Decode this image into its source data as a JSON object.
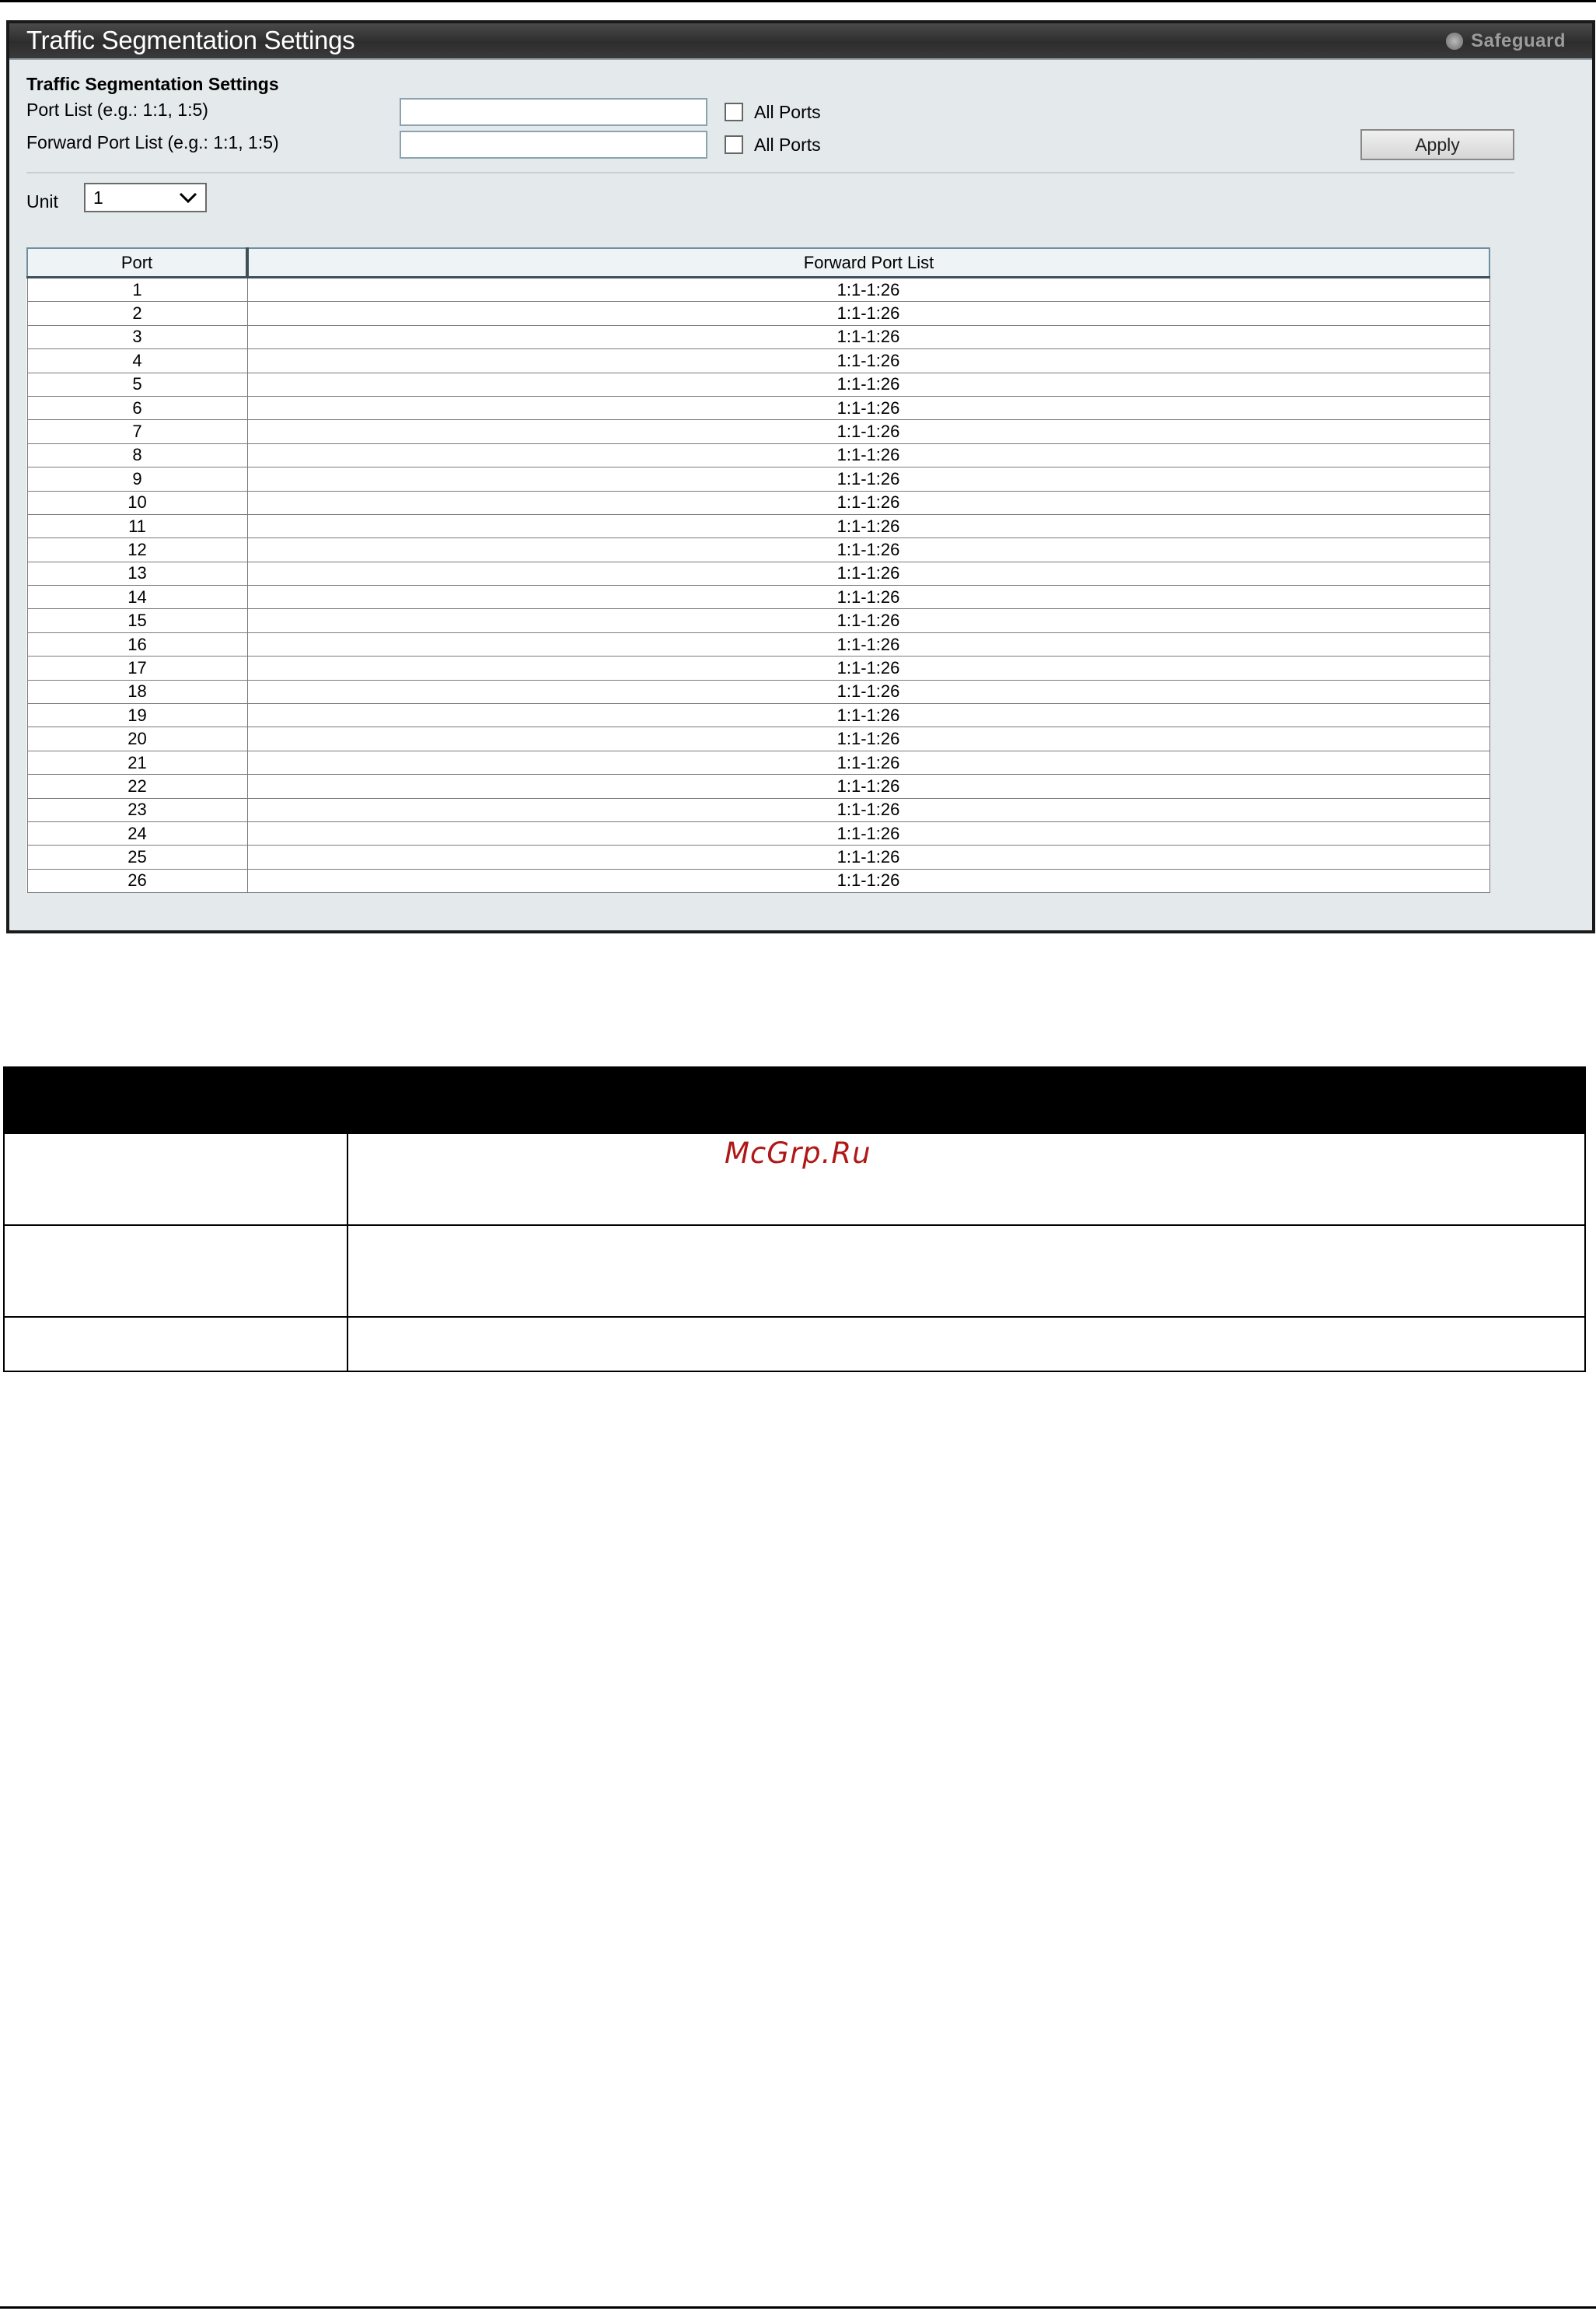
{
  "window": {
    "title": "Traffic Segmentation Settings",
    "safeguard_label": "Safeguard"
  },
  "form": {
    "section_title": "Traffic Segmentation Settings",
    "port_list_label": "Port List (e.g.: 1:1, 1:5)",
    "port_list_value": "",
    "port_all_ports_label": "All Ports",
    "forward_port_list_label": "Forward Port List (e.g.: 1:1, 1:5)",
    "forward_port_list_value": "",
    "forward_all_ports_label": "All Ports",
    "apply_label": "Apply",
    "unit_label": "Unit",
    "unit_value": "1"
  },
  "table": {
    "headers": [
      "Port",
      "Forward Port List"
    ],
    "rows": [
      {
        "port": "1",
        "forward": "1:1-1:26"
      },
      {
        "port": "2",
        "forward": "1:1-1:26"
      },
      {
        "port": "3",
        "forward": "1:1-1:26"
      },
      {
        "port": "4",
        "forward": "1:1-1:26"
      },
      {
        "port": "5",
        "forward": "1:1-1:26"
      },
      {
        "port": "6",
        "forward": "1:1-1:26"
      },
      {
        "port": "7",
        "forward": "1:1-1:26"
      },
      {
        "port": "8",
        "forward": "1:1-1:26"
      },
      {
        "port": "9",
        "forward": "1:1-1:26"
      },
      {
        "port": "10",
        "forward": "1:1-1:26"
      },
      {
        "port": "11",
        "forward": "1:1-1:26"
      },
      {
        "port": "12",
        "forward": "1:1-1:26"
      },
      {
        "port": "13",
        "forward": "1:1-1:26"
      },
      {
        "port": "14",
        "forward": "1:1-1:26"
      },
      {
        "port": "15",
        "forward": "1:1-1:26"
      },
      {
        "port": "16",
        "forward": "1:1-1:26"
      },
      {
        "port": "17",
        "forward": "1:1-1:26"
      },
      {
        "port": "18",
        "forward": "1:1-1:26"
      },
      {
        "port": "19",
        "forward": "1:1-1:26"
      },
      {
        "port": "20",
        "forward": "1:1-1:26"
      },
      {
        "port": "21",
        "forward": "1:1-1:26"
      },
      {
        "port": "22",
        "forward": "1:1-1:26"
      },
      {
        "port": "23",
        "forward": "1:1-1:26"
      },
      {
        "port": "24",
        "forward": "1:1-1:26"
      },
      {
        "port": "25",
        "forward": "1:1-1:26"
      },
      {
        "port": "26",
        "forward": "1:1-1:26"
      }
    ]
  },
  "watermark": "McGrp.Ru"
}
